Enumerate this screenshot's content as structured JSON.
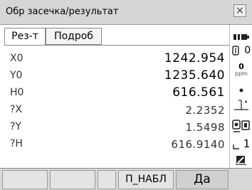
{
  "window": {
    "title": "Обр засечка/результат",
    "close_glyph": "×"
  },
  "tabs": [
    {
      "label": "Рез-т",
      "active": true
    },
    {
      "label": "Подроб",
      "active": false
    }
  ],
  "results": [
    {
      "label": "X0",
      "value": "1242.954"
    },
    {
      "label": "Y0",
      "value": "1235.640"
    },
    {
      "label": "H0",
      "value": "616.561"
    },
    {
      "label": "?X",
      "value": "2.2352"
    },
    {
      "label": "?Y",
      "value": "1.5498"
    },
    {
      "label": "?H",
      "value": "616.9140"
    }
  ],
  "status": {
    "count": "0",
    "ppm_value": "0",
    "ppm_unit": "ppm",
    "mode_digit": "1",
    "icons": [
      "battery-icon",
      "counter-icon",
      "dot-icon",
      "tilt-icon",
      "target-icon",
      "prism-icon",
      "input-mode-icon"
    ]
  },
  "softkeys": [
    {
      "label": ""
    },
    {
      "label": ""
    },
    {
      "label": ""
    },
    {
      "label": "П_НАБЛ"
    },
    {
      "label": "Да"
    }
  ]
}
